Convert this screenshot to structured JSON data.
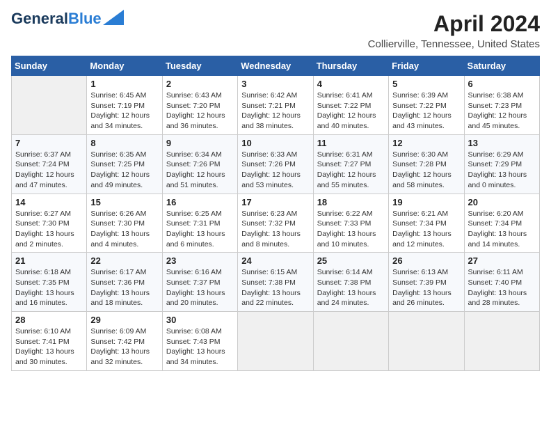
{
  "header": {
    "logo_line1": "General",
    "logo_line2": "Blue",
    "month_title": "April 2024",
    "location": "Collierville, Tennessee, United States"
  },
  "weekdays": [
    "Sunday",
    "Monday",
    "Tuesday",
    "Wednesday",
    "Thursday",
    "Friday",
    "Saturday"
  ],
  "weeks": [
    [
      {
        "day": "",
        "sunrise": "",
        "sunset": "",
        "daylight": ""
      },
      {
        "day": "1",
        "sunrise": "Sunrise: 6:45 AM",
        "sunset": "Sunset: 7:19 PM",
        "daylight": "Daylight: 12 hours and 34 minutes."
      },
      {
        "day": "2",
        "sunrise": "Sunrise: 6:43 AM",
        "sunset": "Sunset: 7:20 PM",
        "daylight": "Daylight: 12 hours and 36 minutes."
      },
      {
        "day": "3",
        "sunrise": "Sunrise: 6:42 AM",
        "sunset": "Sunset: 7:21 PM",
        "daylight": "Daylight: 12 hours and 38 minutes."
      },
      {
        "day": "4",
        "sunrise": "Sunrise: 6:41 AM",
        "sunset": "Sunset: 7:22 PM",
        "daylight": "Daylight: 12 hours and 40 minutes."
      },
      {
        "day": "5",
        "sunrise": "Sunrise: 6:39 AM",
        "sunset": "Sunset: 7:22 PM",
        "daylight": "Daylight: 12 hours and 43 minutes."
      },
      {
        "day": "6",
        "sunrise": "Sunrise: 6:38 AM",
        "sunset": "Sunset: 7:23 PM",
        "daylight": "Daylight: 12 hours and 45 minutes."
      }
    ],
    [
      {
        "day": "7",
        "sunrise": "Sunrise: 6:37 AM",
        "sunset": "Sunset: 7:24 PM",
        "daylight": "Daylight: 12 hours and 47 minutes."
      },
      {
        "day": "8",
        "sunrise": "Sunrise: 6:35 AM",
        "sunset": "Sunset: 7:25 PM",
        "daylight": "Daylight: 12 hours and 49 minutes."
      },
      {
        "day": "9",
        "sunrise": "Sunrise: 6:34 AM",
        "sunset": "Sunset: 7:26 PM",
        "daylight": "Daylight: 12 hours and 51 minutes."
      },
      {
        "day": "10",
        "sunrise": "Sunrise: 6:33 AM",
        "sunset": "Sunset: 7:26 PM",
        "daylight": "Daylight: 12 hours and 53 minutes."
      },
      {
        "day": "11",
        "sunrise": "Sunrise: 6:31 AM",
        "sunset": "Sunset: 7:27 PM",
        "daylight": "Daylight: 12 hours and 55 minutes."
      },
      {
        "day": "12",
        "sunrise": "Sunrise: 6:30 AM",
        "sunset": "Sunset: 7:28 PM",
        "daylight": "Daylight: 12 hours and 58 minutes."
      },
      {
        "day": "13",
        "sunrise": "Sunrise: 6:29 AM",
        "sunset": "Sunset: 7:29 PM",
        "daylight": "Daylight: 13 hours and 0 minutes."
      }
    ],
    [
      {
        "day": "14",
        "sunrise": "Sunrise: 6:27 AM",
        "sunset": "Sunset: 7:30 PM",
        "daylight": "Daylight: 13 hours and 2 minutes."
      },
      {
        "day": "15",
        "sunrise": "Sunrise: 6:26 AM",
        "sunset": "Sunset: 7:30 PM",
        "daylight": "Daylight: 13 hours and 4 minutes."
      },
      {
        "day": "16",
        "sunrise": "Sunrise: 6:25 AM",
        "sunset": "Sunset: 7:31 PM",
        "daylight": "Daylight: 13 hours and 6 minutes."
      },
      {
        "day": "17",
        "sunrise": "Sunrise: 6:23 AM",
        "sunset": "Sunset: 7:32 PM",
        "daylight": "Daylight: 13 hours and 8 minutes."
      },
      {
        "day": "18",
        "sunrise": "Sunrise: 6:22 AM",
        "sunset": "Sunset: 7:33 PM",
        "daylight": "Daylight: 13 hours and 10 minutes."
      },
      {
        "day": "19",
        "sunrise": "Sunrise: 6:21 AM",
        "sunset": "Sunset: 7:34 PM",
        "daylight": "Daylight: 13 hours and 12 minutes."
      },
      {
        "day": "20",
        "sunrise": "Sunrise: 6:20 AM",
        "sunset": "Sunset: 7:34 PM",
        "daylight": "Daylight: 13 hours and 14 minutes."
      }
    ],
    [
      {
        "day": "21",
        "sunrise": "Sunrise: 6:18 AM",
        "sunset": "Sunset: 7:35 PM",
        "daylight": "Daylight: 13 hours and 16 minutes."
      },
      {
        "day": "22",
        "sunrise": "Sunrise: 6:17 AM",
        "sunset": "Sunset: 7:36 PM",
        "daylight": "Daylight: 13 hours and 18 minutes."
      },
      {
        "day": "23",
        "sunrise": "Sunrise: 6:16 AM",
        "sunset": "Sunset: 7:37 PM",
        "daylight": "Daylight: 13 hours and 20 minutes."
      },
      {
        "day": "24",
        "sunrise": "Sunrise: 6:15 AM",
        "sunset": "Sunset: 7:38 PM",
        "daylight": "Daylight: 13 hours and 22 minutes."
      },
      {
        "day": "25",
        "sunrise": "Sunrise: 6:14 AM",
        "sunset": "Sunset: 7:38 PM",
        "daylight": "Daylight: 13 hours and 24 minutes."
      },
      {
        "day": "26",
        "sunrise": "Sunrise: 6:13 AM",
        "sunset": "Sunset: 7:39 PM",
        "daylight": "Daylight: 13 hours and 26 minutes."
      },
      {
        "day": "27",
        "sunrise": "Sunrise: 6:11 AM",
        "sunset": "Sunset: 7:40 PM",
        "daylight": "Daylight: 13 hours and 28 minutes."
      }
    ],
    [
      {
        "day": "28",
        "sunrise": "Sunrise: 6:10 AM",
        "sunset": "Sunset: 7:41 PM",
        "daylight": "Daylight: 13 hours and 30 minutes."
      },
      {
        "day": "29",
        "sunrise": "Sunrise: 6:09 AM",
        "sunset": "Sunset: 7:42 PM",
        "daylight": "Daylight: 13 hours and 32 minutes."
      },
      {
        "day": "30",
        "sunrise": "Sunrise: 6:08 AM",
        "sunset": "Sunset: 7:43 PM",
        "daylight": "Daylight: 13 hours and 34 minutes."
      },
      {
        "day": "",
        "sunrise": "",
        "sunset": "",
        "daylight": ""
      },
      {
        "day": "",
        "sunrise": "",
        "sunset": "",
        "daylight": ""
      },
      {
        "day": "",
        "sunrise": "",
        "sunset": "",
        "daylight": ""
      },
      {
        "day": "",
        "sunrise": "",
        "sunset": "",
        "daylight": ""
      }
    ]
  ]
}
